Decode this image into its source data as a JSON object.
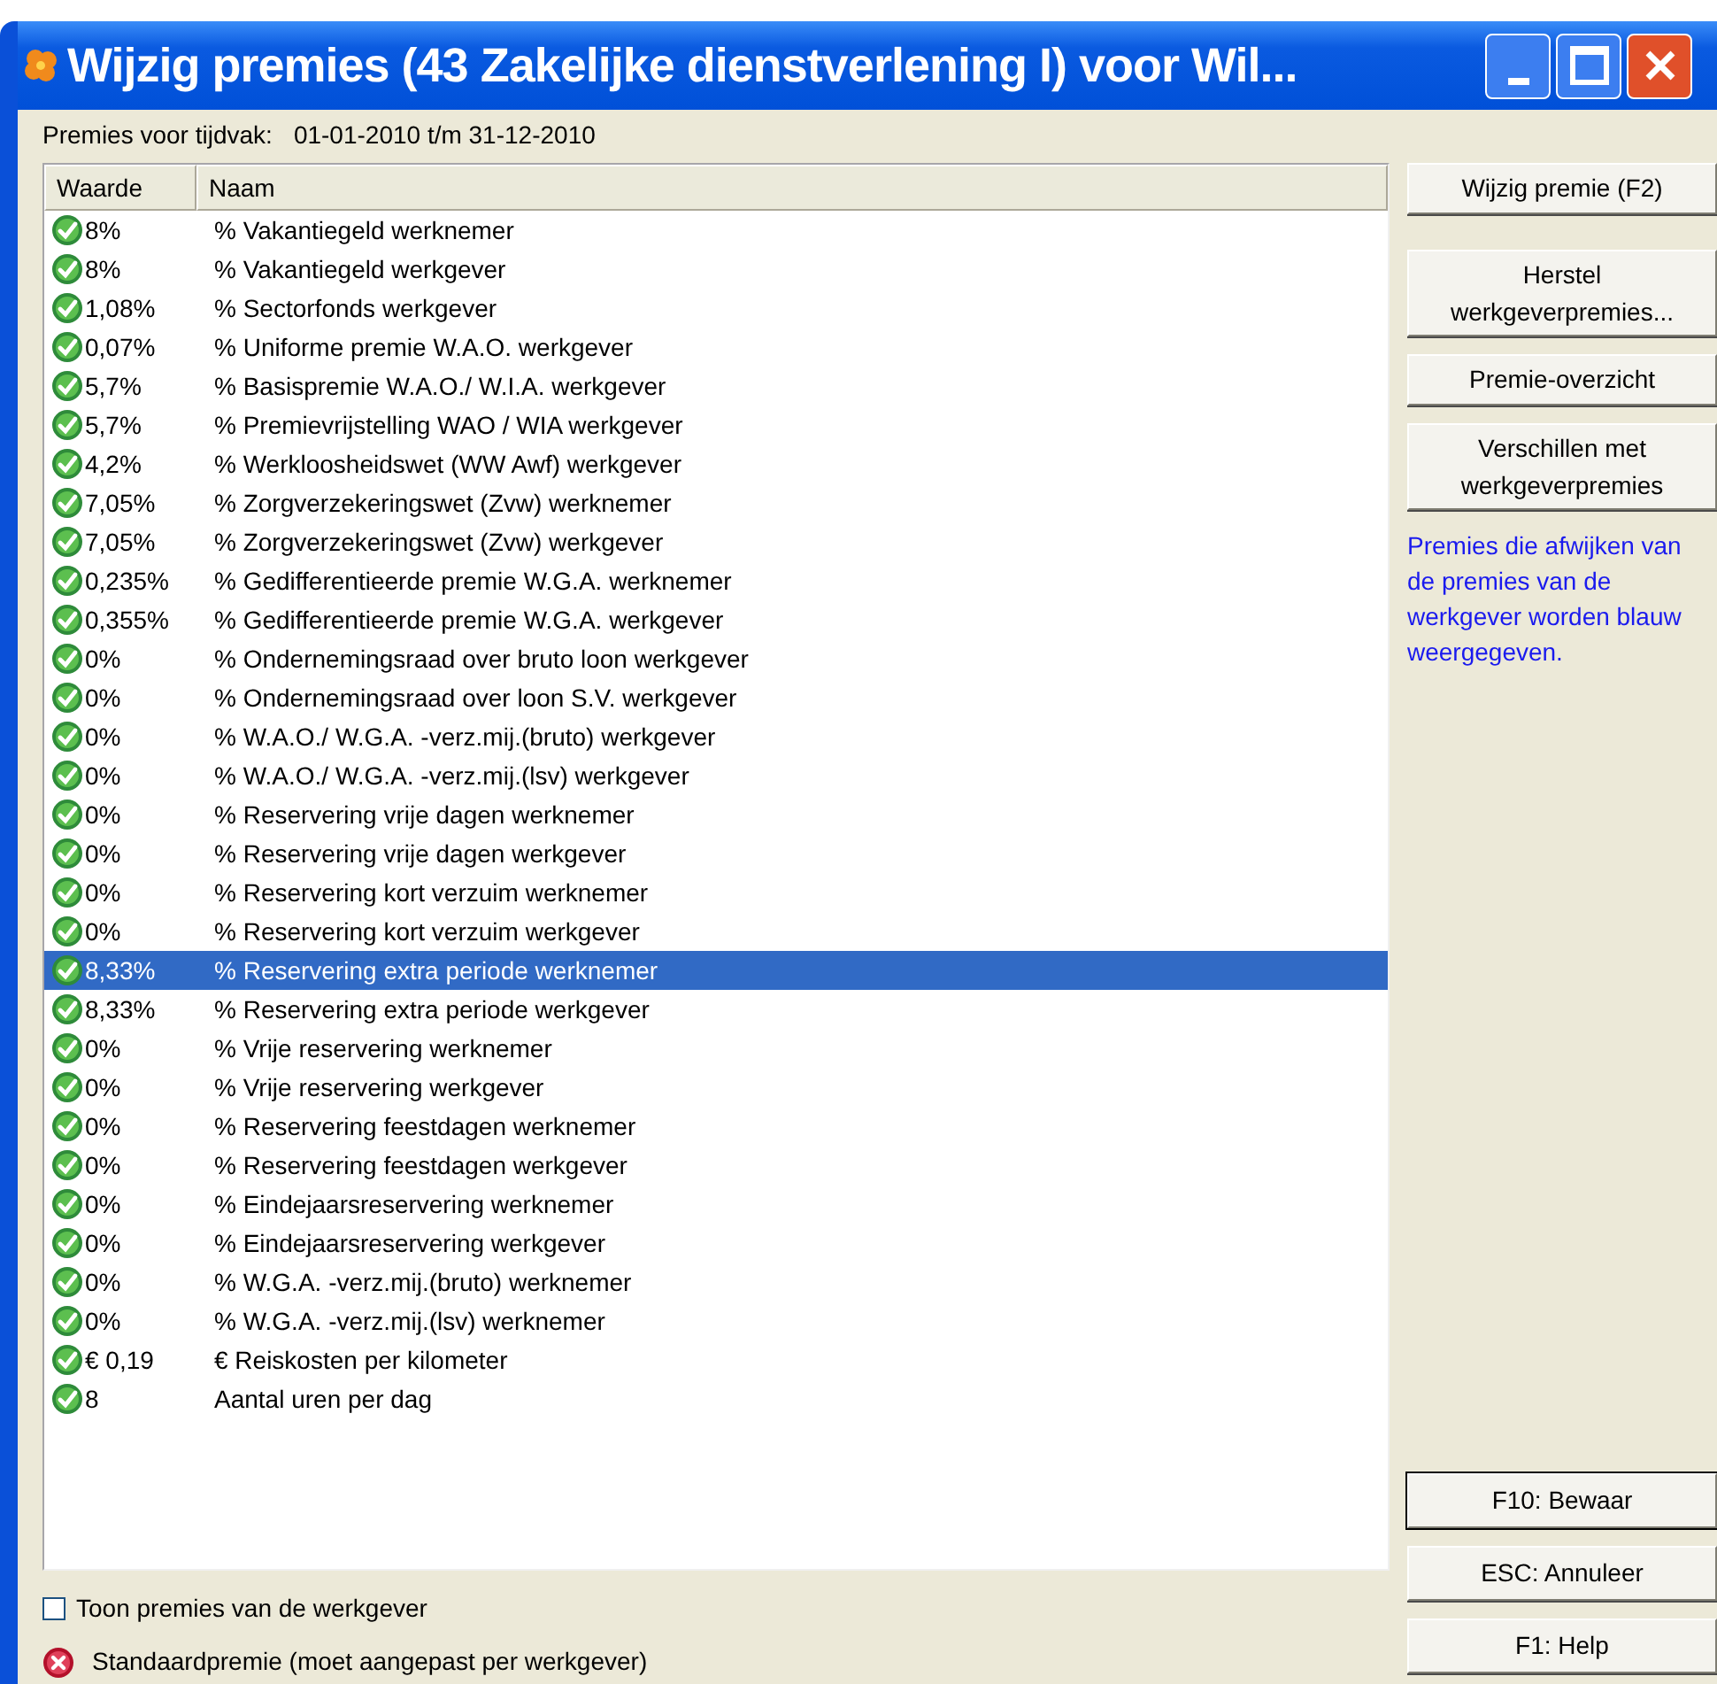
{
  "window": {
    "title": "Wijzig premies (43 Zakelijke dienstverlening I) voor Wil..."
  },
  "period": {
    "label": "Premies voor tijdvak:",
    "value": "01-01-2010 t/m 31-12-2010"
  },
  "table": {
    "columns": [
      "Waarde",
      "Naam"
    ],
    "rows": [
      {
        "kind": "ok",
        "selected": false,
        "value": "8%",
        "name": "% Vakantiegeld werknemer"
      },
      {
        "kind": "ok",
        "selected": false,
        "value": "8%",
        "name": "% Vakantiegeld werkgever"
      },
      {
        "kind": "ok",
        "selected": false,
        "value": "1,08%",
        "name": "% Sectorfonds werkgever"
      },
      {
        "kind": "ok",
        "selected": false,
        "value": "0,07%",
        "name": "% Uniforme premie W.A.O. werkgever"
      },
      {
        "kind": "ok",
        "selected": false,
        "value": "5,7%",
        "name": "% Basispremie W.A.O./ W.I.A. werkgever"
      },
      {
        "kind": "ok",
        "selected": false,
        "value": "5,7%",
        "name": "% Premievrijstelling WAO / WIA werkgever"
      },
      {
        "kind": "ok",
        "selected": false,
        "value": "4,2%",
        "name": "% Werkloosheidswet (WW Awf) werkgever"
      },
      {
        "kind": "ok",
        "selected": false,
        "value": "7,05%",
        "name": "% Zorgverzekeringswet (Zvw) werknemer"
      },
      {
        "kind": "ok",
        "selected": false,
        "value": "7,05%",
        "name": "% Zorgverzekeringswet (Zvw) werkgever"
      },
      {
        "kind": "ok",
        "selected": false,
        "value": "0,235%",
        "name": "% Gedifferentieerde premie W.G.A. werknemer"
      },
      {
        "kind": "ok",
        "selected": false,
        "value": "0,355%",
        "name": "% Gedifferentieerde premie W.G.A. werkgever"
      },
      {
        "kind": "ok",
        "selected": false,
        "value": "0%",
        "name": "% Ondernemingsraad over bruto loon werkgever"
      },
      {
        "kind": "ok",
        "selected": false,
        "value": "0%",
        "name": "% Ondernemingsraad over loon S.V. werkgever"
      },
      {
        "kind": "ok",
        "selected": false,
        "value": "0%",
        "name": "% W.A.O./ W.G.A. -verz.mij.(bruto) werkgever"
      },
      {
        "kind": "ok",
        "selected": false,
        "value": "0%",
        "name": "% W.A.O./ W.G.A. -verz.mij.(lsv) werkgever"
      },
      {
        "kind": "ok",
        "selected": false,
        "value": "0%",
        "name": "% Reservering vrije dagen werknemer"
      },
      {
        "kind": "ok",
        "selected": false,
        "value": "0%",
        "name": "% Reservering vrije dagen werkgever"
      },
      {
        "kind": "ok",
        "selected": false,
        "value": "0%",
        "name": "% Reservering kort verzuim werknemer"
      },
      {
        "kind": "ok",
        "selected": false,
        "value": "0%",
        "name": "% Reservering kort verzuim werkgever"
      },
      {
        "kind": "ok",
        "selected": true,
        "value": "8,33%",
        "name": "% Reservering extra periode werknemer"
      },
      {
        "kind": "ok",
        "selected": false,
        "value": "8,33%",
        "name": "% Reservering extra periode werkgever"
      },
      {
        "kind": "ok",
        "selected": false,
        "value": "0%",
        "name": "% Vrije reservering werknemer"
      },
      {
        "kind": "ok",
        "selected": false,
        "value": "0%",
        "name": "% Vrije reservering werkgever"
      },
      {
        "kind": "ok",
        "selected": false,
        "value": "0%",
        "name": "% Reservering feestdagen werknemer"
      },
      {
        "kind": "ok",
        "selected": false,
        "value": "0%",
        "name": "% Reservering feestdagen werkgever"
      },
      {
        "kind": "ok",
        "selected": false,
        "value": "0%",
        "name": "% Eindejaarsreservering werknemer"
      },
      {
        "kind": "ok",
        "selected": false,
        "value": "0%",
        "name": "% Eindejaarsreservering werkgever"
      },
      {
        "kind": "ok",
        "selected": false,
        "value": "0%",
        "name": "% W.G.A. -verz.mij.(bruto) werknemer"
      },
      {
        "kind": "ok",
        "selected": false,
        "value": "0%",
        "name": "% W.G.A. -verz.mij.(lsv) werknemer"
      },
      {
        "kind": "ok",
        "selected": false,
        "value": "€ 0,19",
        "name": "€ Reiskosten per kilometer"
      },
      {
        "kind": "ok",
        "selected": false,
        "value": "8",
        "name": "Aantal uren per dag"
      }
    ]
  },
  "side_buttons_list": [
    "Wijzig premie (F2)",
    "Herstel werkgeverpremies...",
    "Premie-overzicht",
    "Verschillen met werkgeverpremies"
  ],
  "note": "Premies die afwijken van de premies van de werkgever worden blauw weergegeven.",
  "bottom_buttons": [
    {
      "label": "F10: Bewaar",
      "default": true
    },
    {
      "label": "ESC: Annuleer",
      "default": false
    },
    {
      "label": "F1: Help",
      "default": false
    }
  ],
  "checkbox": {
    "label": "Toon premies van de werkgever",
    "checked": false
  },
  "legend": {
    "kind": "error",
    "text": "Standaardpremie (moet aangepast per werkgever)"
  }
}
